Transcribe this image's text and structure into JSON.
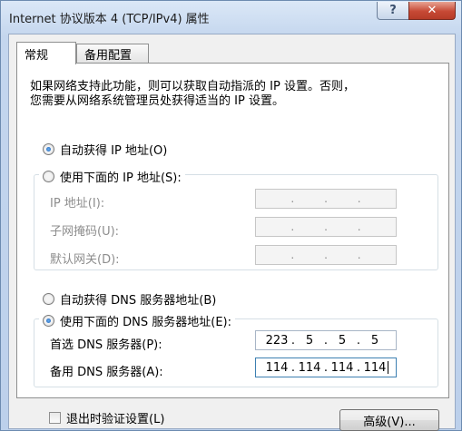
{
  "window": {
    "title": "Internet 协议版本 4 (TCP/IPv4) 属性",
    "help_label": "?",
    "close_label": "✕"
  },
  "tabs": [
    {
      "label": "常规",
      "active": true
    },
    {
      "label": "备用配置",
      "active": false
    }
  ],
  "description_line1": "如果网络支持此功能，则可以获取自动指派的 IP 设置。否则，",
  "description_line2": "您需要从网络系统管理员处获得适当的 IP 设置。",
  "ip_section": {
    "auto_label": "自动获得 IP 地址(O)",
    "auto_checked": true,
    "manual_label": "使用下面的 IP 地址(S):",
    "manual_checked": false,
    "fields": [
      {
        "label": "IP 地址(I):",
        "value": ""
      },
      {
        "label": "子网掩码(U):",
        "value": ""
      },
      {
        "label": "默认网关(D):",
        "value": ""
      }
    ]
  },
  "dns_section": {
    "auto_label": "自动获得 DNS 服务器地址(B)",
    "auto_checked": false,
    "manual_label": "使用下面的 DNS 服务器地址(E):",
    "manual_checked": true,
    "preferred": {
      "label": "首选 DNS 服务器(P):",
      "octets": [
        "223",
        "5",
        "5",
        "5"
      ]
    },
    "alternate": {
      "label": "备用 DNS 服务器(A):",
      "octets": [
        "114",
        "114",
        "114",
        "114"
      ]
    }
  },
  "validate_label": "退出时验证设置(L)",
  "validate_checked": false,
  "advanced_label": "高级(V)..."
}
